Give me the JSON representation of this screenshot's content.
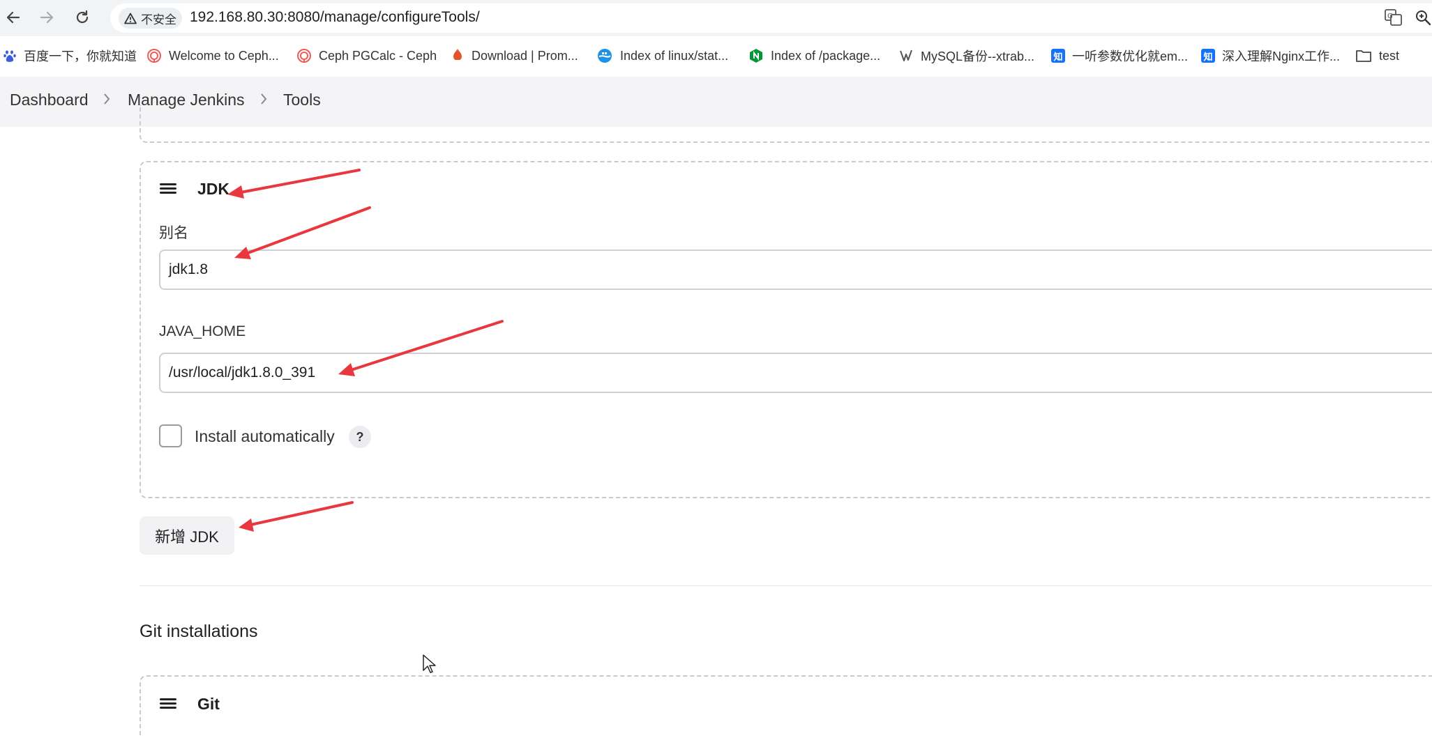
{
  "browser": {
    "security_label": "不安全",
    "url": "192.168.80.30:8080/manage/configureTools/"
  },
  "bookmarks": [
    {
      "label": "百度一下，你就知道",
      "icon": "baidu-icon"
    },
    {
      "label": "Welcome to Ceph...",
      "icon": "ceph-icon"
    },
    {
      "label": "Ceph PGCalc - Ceph",
      "icon": "ceph-icon"
    },
    {
      "label": "Download | Prom...",
      "icon": "prometheus-icon"
    },
    {
      "label": "Index of linux/stat...",
      "icon": "docker-icon"
    },
    {
      "label": "Index of /package...",
      "icon": "nginx-icon"
    },
    {
      "label": "MySQL备份--xtrab...",
      "icon": "mysql-icon"
    },
    {
      "label": "一听参数优化就em...",
      "icon": "zhihu-icon"
    },
    {
      "label": "深入理解Nginx工作...",
      "icon": "zhihu-icon"
    },
    {
      "label": "test",
      "icon": "folder-icon"
    }
  ],
  "breadcrumb": {
    "items": [
      "Dashboard",
      "Manage Jenkins",
      "Tools"
    ]
  },
  "jdk_card": {
    "title": "JDK",
    "name_label": "别名",
    "name_value": "jdk1.8",
    "home_label": "JAVA_HOME",
    "home_value": "/usr/local/jdk1.8.0_391",
    "install_label": "Install automatically",
    "help_label": "?"
  },
  "add_jdk_label": "新增 JDK",
  "git_section": {
    "heading": "Git installations",
    "card_title": "Git"
  },
  "colors": {
    "annotation_arrow": "#e8383d",
    "zhihu_blue": "#1772f6",
    "nginx_green": "#009639"
  }
}
